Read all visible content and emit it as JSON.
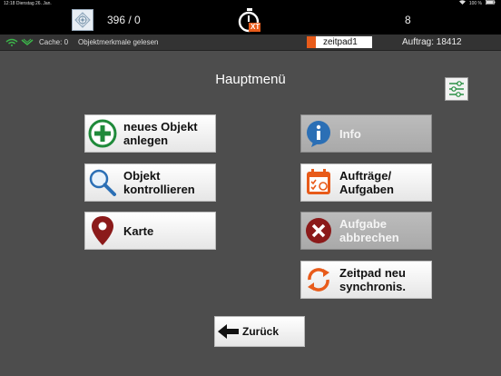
{
  "status_bar": {
    "time": "12:18",
    "date": "Dienstag 26. Jan.",
    "battery": "100 %"
  },
  "top_bar": {
    "counter": "396 / 0",
    "count_right": "8",
    "logo_text": "XT"
  },
  "info_bar": {
    "cache": "Cache: 0",
    "message": "Objektmerkmale gelesen",
    "pad_name": "zeitpad1",
    "auftrag": "Auftrag: 18412"
  },
  "main": {
    "title": "Hauptmenü",
    "buttons": {
      "new_object": "neues Objekt\nanlegen",
      "check_object": "Objekt\nkontrollieren",
      "map": "Karte",
      "info": "Info",
      "orders": "Aufträge/\nAufgaben",
      "cancel_task": "Aufgabe\nabbrechen",
      "sync": "Zeitpad neu\nsynchronis."
    },
    "back": "Zurück"
  },
  "colors": {
    "background": "#4d4d4d",
    "accent_orange": "#e85b1a",
    "green": "#1f8a3a",
    "blue": "#2b6fb5",
    "red": "#8b1a1a"
  }
}
